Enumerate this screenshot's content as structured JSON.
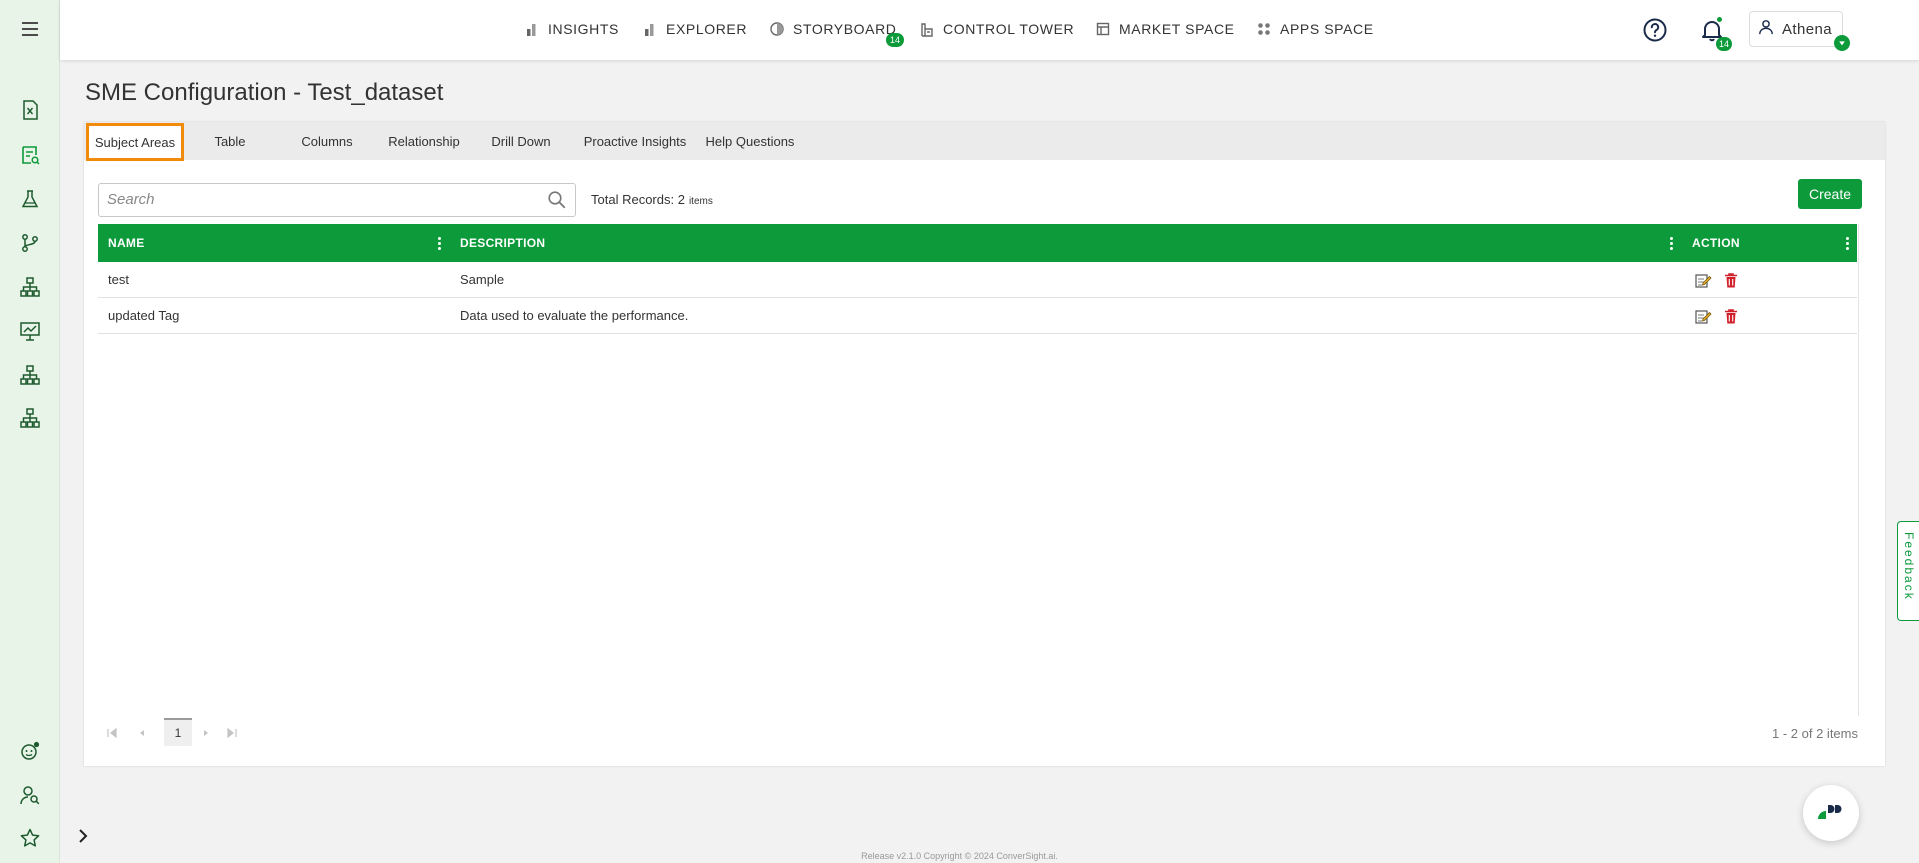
{
  "topnav": {
    "items": [
      {
        "label": "INSIGHTS",
        "icon": "insights-bar-icon"
      },
      {
        "label": "EXPLORER",
        "icon": "explorer-bar-icon"
      },
      {
        "label": "STORYBOARD",
        "icon": "storyboard-icon",
        "badge": "14"
      },
      {
        "label": "CONTROL TOWER",
        "icon": "control-tower-icon"
      },
      {
        "label": "MARKET SPACE",
        "icon": "market-space-icon"
      },
      {
        "label": "APPS SPACE",
        "icon": "apps-space-icon"
      }
    ],
    "notification_badge": "14",
    "user_name": "Athena"
  },
  "page": {
    "title": "SME Configuration - Test_dataset"
  },
  "tabs": [
    {
      "label": "Subject Areas",
      "active": true
    },
    {
      "label": "Table"
    },
    {
      "label": "Columns"
    },
    {
      "label": "Relationship"
    },
    {
      "label": "Drill Down"
    },
    {
      "label": "Proactive Insights"
    },
    {
      "label": "Help Questions"
    }
  ],
  "toolbar": {
    "search_placeholder": "Search",
    "total_label": "Total Records: 2",
    "total_suffix": "items",
    "create_label": "Create"
  },
  "grid": {
    "columns": [
      "NAME",
      "DESCRIPTION",
      "ACTION"
    ],
    "rows": [
      {
        "name": "test",
        "description": "Sample"
      },
      {
        "name": "updated Tag",
        "description": "Data used to evaluate the performance."
      }
    ]
  },
  "pager": {
    "current_page": "1",
    "info": "1 - 2 of 2 items"
  },
  "footer": {
    "text": "Release v2.1.0 Copyright © 2024 ConverSight.ai."
  },
  "feedback_label": "Feedback",
  "colors": {
    "brand_green": "#0c9a3a",
    "active_tab_border": "#f28b0c",
    "delete_red": "#d0202a"
  }
}
